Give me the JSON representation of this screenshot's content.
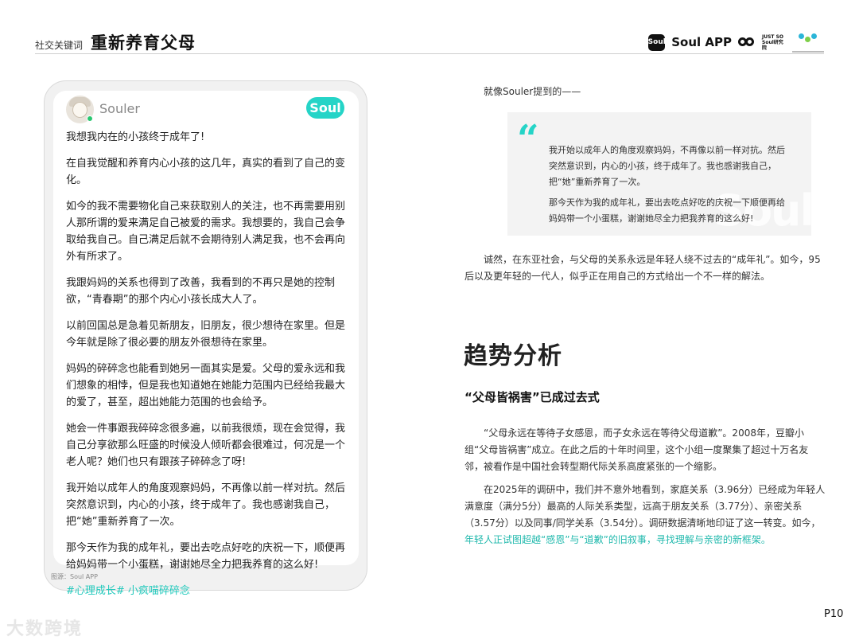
{
  "header": {
    "keyword_label": "社交关键词",
    "title": "重新养育父母",
    "brand_icon_text": "Soul",
    "brand_app": "Soul APP",
    "brand_small": "JUST SO Soul研究院"
  },
  "post": {
    "username": "Souler",
    "badge": "Soul",
    "paragraphs": [
      "我想我内在的小孩终于成年了!",
      "在自我觉醒和养育内心小孩的这几年，真实的看到了自己的变化。",
      "如今的我不需要物化自己来获取别人的关注，也不再需要用别人那所谓的爱来满足自己被爱的需求。我想要的，我自己会争取给我自己。自己满足后就不会期待别人满足我，也不会再向外有所求了。",
      "我跟妈妈的关系也得到了改善，我看到的不再只是她的控制欲，“青春期”的那个内心小孩长成大人了。",
      "以前回国总是急着见新朋友，旧朋友，很少想待在家里。但是今年就是除了很必要的朋友外很想待在家里。",
      "妈妈的碎碎念也能看到她另一面其实是爱。父母的爱永远和我们想象的相悖，但是我也知道她在她能力范围内已经给我最大的爱了，甚至，超出她能力范围的也会给予。",
      "她会一件事跟我碎碎念很多遍，以前我很烦，现在会觉得，我自己分享欲那么旺盛的时候没人倾听都会很难过，何况是一个老人呢？她们也只有跟孩子碎碎念了呀!",
      "我开始以成年人的角度观察妈妈，不再像以前一样对抗。然后突然意识到，内心的小孩，终于成年了。我也感谢我自己，把“她”重新养育了一次。",
      "那今天作为我的成年礼，要出去吃点好吃的庆祝一下，顺便再给妈妈带一个小蛋糕，谢谢她尽全力把我养育的这么好!"
    ],
    "tags": "#心理成长# 小疯喵碎碎念",
    "source": "图源：Soul APP"
  },
  "right": {
    "lead": "就像Souler提到的——",
    "quote_mark": "“",
    "quote_1": "我开始以成年人的角度观察妈妈，不再像以前一样对抗。然后突然意识到，内心的小孩，终于成年了。我也感谢我自己，把“她”重新养育了一次。",
    "quote_2": "那今天作为我的成年礼，要出去吃点好吃的庆祝一下顺便再给妈妈带一个小蛋糕，谢谢她尽全力把我养育的这么好!",
    "watermark": "Soul",
    "para1": "诚然，在东亚社会，与父母的关系永远是年轻人绕不过去的“成年礼”。如今，95后以及更年轻的一代人，似乎正在用自己的方式给出一个不一样的解法。",
    "section_title": "趋势分析",
    "sub_title": "“父母皆祸害”已成过去式",
    "para2": "“父母永远在等待子女感恩，而子女永远在等待父母道歉”。2008年，豆瓣小组“父母皆祸害”成立。在此之后的十年时间里，这个小组一度聚集了超过十万名友邻，被看作是中国社会转型期代际关系高度紧张的一个缩影。",
    "para3_a": "在2025年的调研中，我们并不意外地看到，家庭关系（3.96分）已经成为年轻人满意度（满分5分）最高的人际关系类型，远高于朋友关系（3.77分）、亲密关系（3.57分）以及同事/同学关系（3.54分）。调研数据清晰地印证了这一转变。如今，",
    "para3_b": "年轻人正试图超越“感恩”与“道歉”的旧叙事，寻找理解与亲密的新框架。"
  },
  "page_number": "P10",
  "footer_watermark": "大数跨境",
  "colors": {
    "accent": "#25d4c7",
    "highlight": "#21b9ad"
  }
}
